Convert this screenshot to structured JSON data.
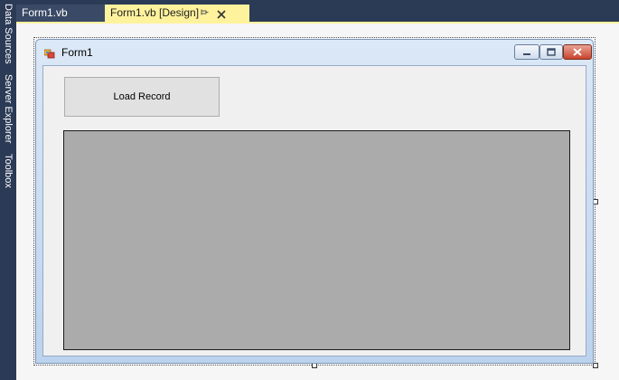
{
  "side_panels": {
    "data_sources": "Data Sources",
    "server_explorer": "Server Explorer",
    "toolbox": "Toolbox"
  },
  "tabs": [
    {
      "label": "Form1.vb",
      "active": false
    },
    {
      "label": "Form1.vb [Design]",
      "active": true
    }
  ],
  "tab_icons": {
    "pin": "pin-icon",
    "close": "close-icon"
  },
  "form": {
    "title": "Form1",
    "icon": "form-app-icon",
    "controls": {
      "minimize": "minimize-icon",
      "maximize": "maximize-icon",
      "close": "close-icon"
    }
  },
  "load_button": {
    "label": "Load Record"
  },
  "colors": {
    "ide_background": "#2b3a55",
    "active_tab": "#fff29d",
    "designer_surface": "#f6f6f6",
    "grid_fill": "#ababab",
    "close_button": "#c9432c"
  }
}
